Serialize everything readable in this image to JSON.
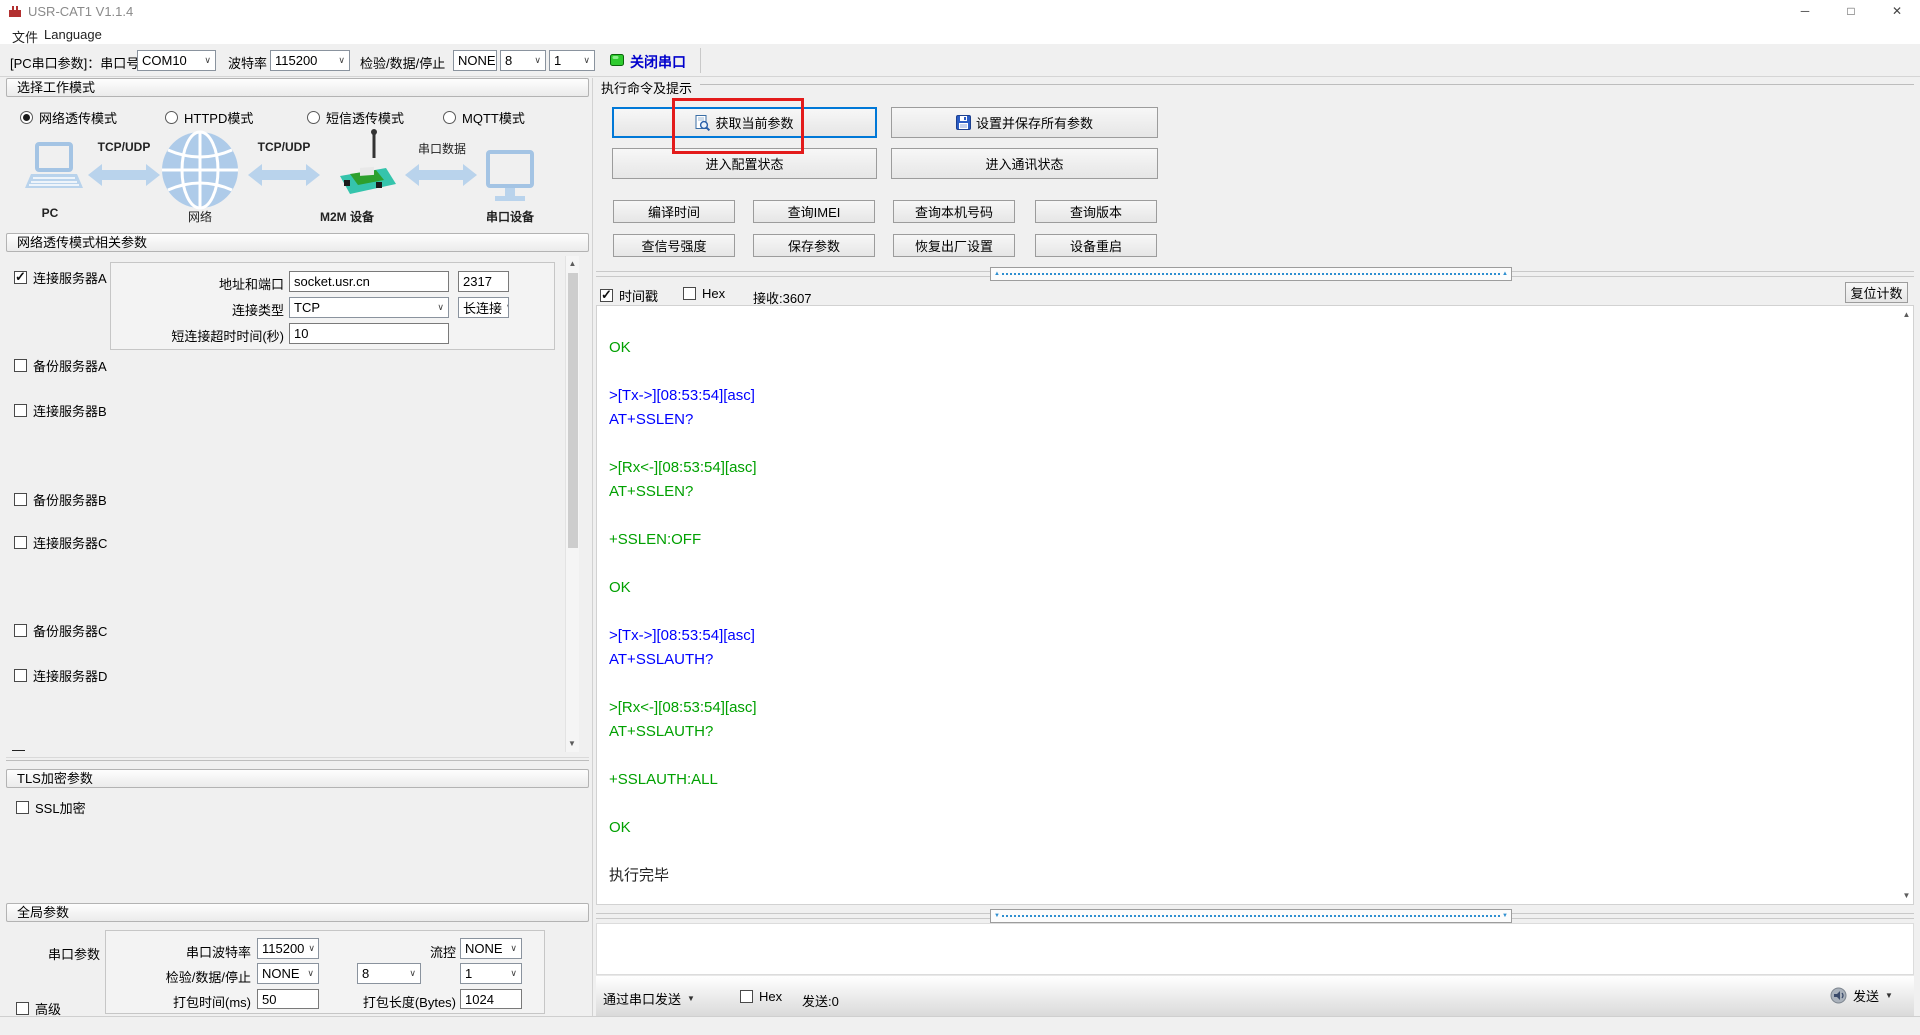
{
  "window": {
    "title": "USR-CAT1 V1.1.4",
    "minimize": "─",
    "maximize": "□",
    "close": "✕"
  },
  "menu": {
    "file": "文件",
    "language": "Language"
  },
  "toolbar": {
    "pc_serial_label": "[PC串口参数]：串口号",
    "com_port": "COM10",
    "baud_label": "波特率",
    "baud": "115200",
    "parity_label": "检验/数据/停止",
    "parity": "NONE",
    "data_bits": "8",
    "stop_bits": "1",
    "close_serial": "关闭串口"
  },
  "work_mode": {
    "header": "选择工作模式",
    "modes": [
      "网络透传模式",
      "HTTPD模式",
      "短信透传模式",
      "MQTT模式"
    ],
    "selected": "网络透传模式",
    "diagram": {
      "nodes": [
        "PC",
        "网络",
        "M2M 设备",
        "串口设备"
      ],
      "links": [
        "TCP/UDP",
        "TCP/UDP",
        "串口数据"
      ]
    }
  },
  "net": {
    "header": "网络透传模式相关参数",
    "server_a": {
      "label": "连接服务器A",
      "checked": true,
      "addr_label": "地址和端口",
      "addr": "socket.usr.cn",
      "port": "2317",
      "type_label": "连接类型",
      "type": "TCP",
      "keep": "长连接",
      "timeout_label": "短连接超时时间(秒)",
      "timeout": "10"
    },
    "others": [
      "备份服务器A",
      "连接服务器B",
      "备份服务器B",
      "连接服务器C",
      "备份服务器C",
      "连接服务器D"
    ],
    "clipped": "—"
  },
  "tls": {
    "header": "TLS加密参数",
    "ssl_label": "SSL加密",
    "ssl_checked": false
  },
  "global": {
    "header": "全局参数",
    "serial_group": "串口参数",
    "baud_label": "串口波特率",
    "baud": "115200",
    "flow_label": "流控",
    "flow": "NONE",
    "parity_label": "检验/数据/停止",
    "parity": "NONE",
    "data_bits": "8",
    "stop_bits": "1",
    "pack_time_label": "打包时间(ms)",
    "pack_time": "50",
    "pack_len_label": "打包长度(Bytes)",
    "pack_len": "1024",
    "advanced_label": "高级",
    "advanced_checked": false
  },
  "cmd": {
    "header": "执行命令及提示",
    "get_params": "获取当前参数",
    "set_save": "设置并保存所有参数",
    "enter_config": "进入配置状态",
    "enter_comm": "进入通讯状态",
    "small_buttons": [
      "编译时间",
      "查询IMEI",
      "查询本机号码",
      "查询版本",
      "查信号强度",
      "保存参数",
      "恢复出厂设置",
      "设备重启"
    ]
  },
  "recv": {
    "timestamp_label": "时间戳",
    "timestamp_checked": true,
    "hex_label": "Hex",
    "hex_checked": false,
    "recv_count": "接收:3607",
    "reset_count": "复位计数"
  },
  "terminal": {
    "lines": [
      {
        "t": "OK",
        "c": "g"
      },
      {
        "t": "",
        "c": "g"
      },
      {
        "t": ">[Tx->][08:53:54][asc]",
        "c": "b"
      },
      {
        "t": "AT+SSLEN?",
        "c": "b"
      },
      {
        "t": "",
        "c": "g"
      },
      {
        "t": ">[Rx<-][08:53:54][asc]",
        "c": "g"
      },
      {
        "t": "AT+SSLEN?",
        "c": "g"
      },
      {
        "t": "",
        "c": "g"
      },
      {
        "t": "+SSLEN:OFF",
        "c": "g"
      },
      {
        "t": "",
        "c": "g"
      },
      {
        "t": "OK",
        "c": "g"
      },
      {
        "t": "",
        "c": "g"
      },
      {
        "t": ">[Tx->][08:53:54][asc]",
        "c": "b"
      },
      {
        "t": "AT+SSLAUTH?",
        "c": "b"
      },
      {
        "t": "",
        "c": "g"
      },
      {
        "t": ">[Rx<-][08:53:54][asc]",
        "c": "g"
      },
      {
        "t": "AT+SSLAUTH?",
        "c": "g"
      },
      {
        "t": "",
        "c": "g"
      },
      {
        "t": "+SSLAUTH:ALL",
        "c": "g"
      },
      {
        "t": "",
        "c": "g"
      },
      {
        "t": "OK",
        "c": "g"
      },
      {
        "t": "",
        "c": "g"
      },
      {
        "t": "执行完毕",
        "c": "k"
      }
    ]
  },
  "send": {
    "via_serial": "通过串口发送",
    "hex_label": "Hex",
    "sent_count": "发送:0",
    "send_label": "发送"
  }
}
